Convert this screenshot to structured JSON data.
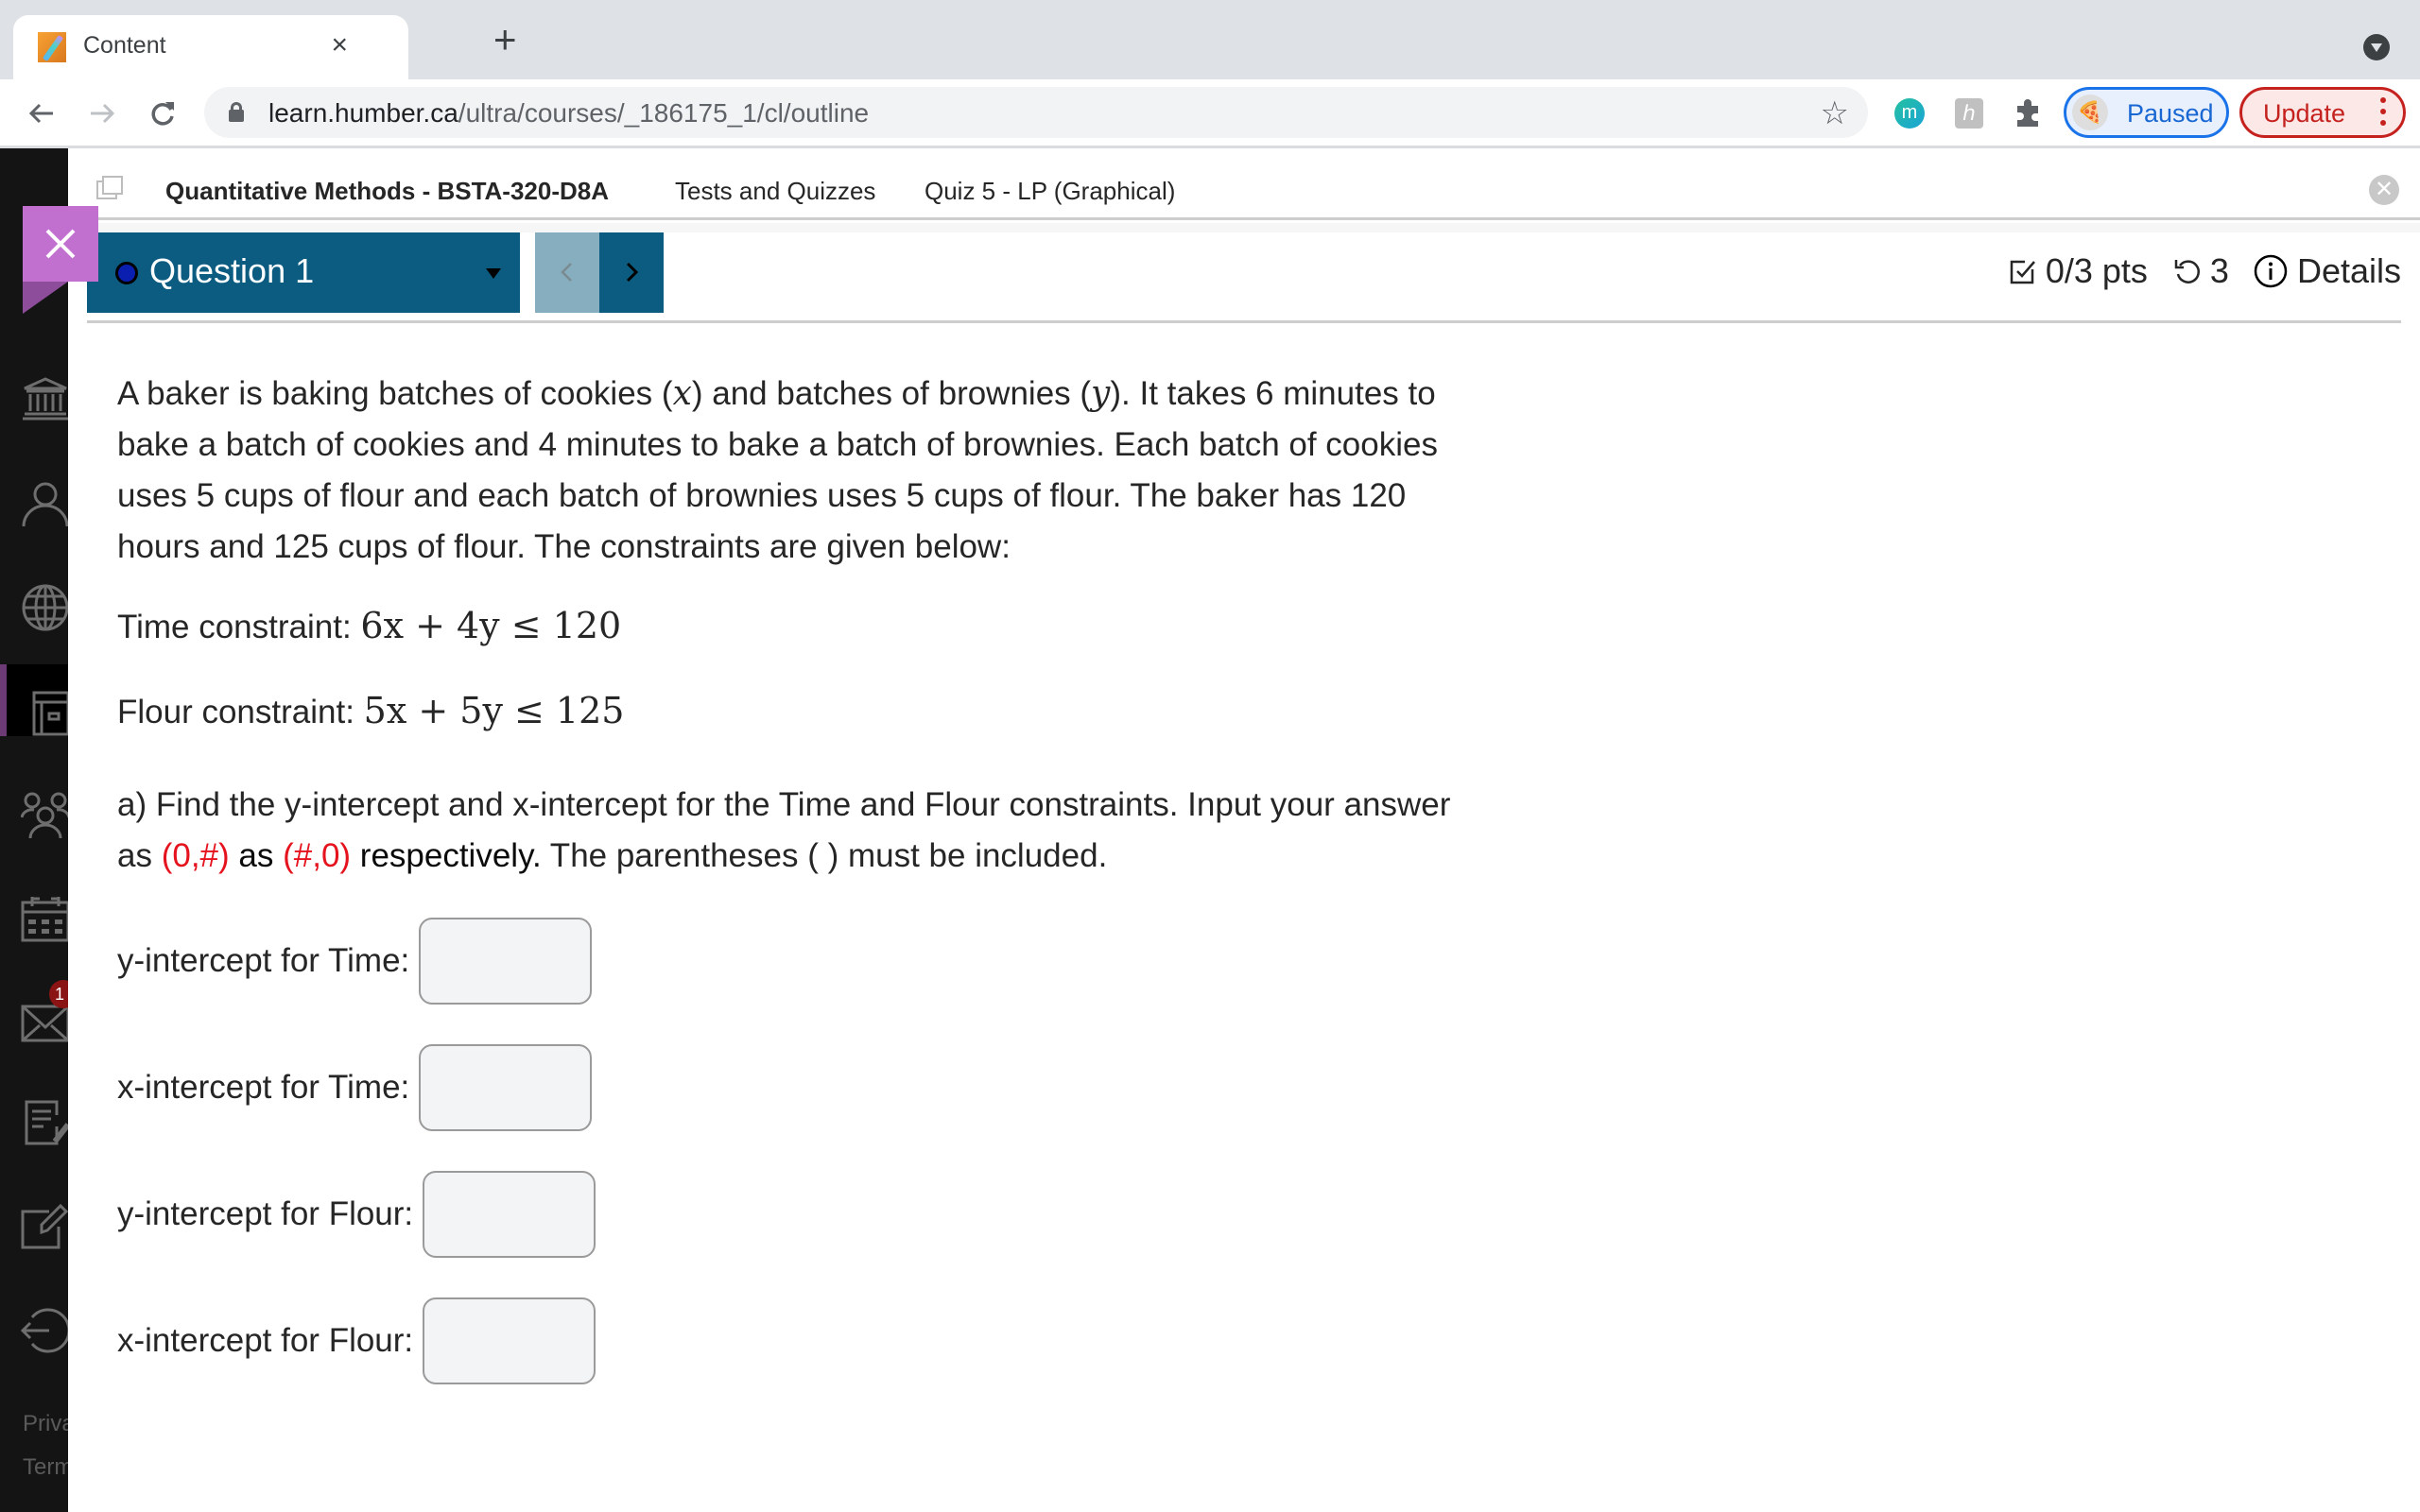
{
  "browser": {
    "tab_title": "Content",
    "tab_close": "×",
    "new_tab": "+",
    "url_host": "learn.humber.ca",
    "url_path": "/ultra/courses/_186175_1/cl/outline",
    "extension_m_label": "m",
    "extension_h_label": "ℎ",
    "profile_label": "Paused",
    "update_label": "Update",
    "star": "☆"
  },
  "leftnav": {
    "items": [
      {
        "name": "institution"
      },
      {
        "name": "profile"
      },
      {
        "name": "activity"
      },
      {
        "name": "courses",
        "active": true
      },
      {
        "name": "organizations"
      },
      {
        "name": "calendar"
      },
      {
        "name": "messages",
        "badge": "1"
      },
      {
        "name": "grades"
      },
      {
        "name": "tools"
      },
      {
        "name": "sign-out"
      }
    ],
    "footer": [
      "Privacy",
      "Terms"
    ]
  },
  "breadcrumb": {
    "course": "Quantitative Methods - BSTA-320-D8A",
    "section": "Tests and Quizzes",
    "page": "Quiz 5 - LP (Graphical)",
    "close": "✕"
  },
  "question_nav": {
    "current": "Question 1",
    "status_color": "#0a1fb0",
    "prev_enabled": false,
    "next_enabled": true
  },
  "question_meta": {
    "points": "0/3 pts",
    "attempts": "3",
    "details_label": "Details"
  },
  "question": {
    "p1_a": "A baker is baking batches of cookies (",
    "var_x": "x",
    "p1_b": ") and batches of brownies (",
    "var_y": "y",
    "p1_c": "). It takes 6 minutes to bake a batch of cookies and 4 minutes to bake a batch of brownies.  Each batch of cookies uses 5 cups of flour and each batch of brownies uses 5 cups of flour. The baker has 120 hours and 125 cups of flour. The constraints are given below:",
    "time_label": "Time constraint: ",
    "time_expr": "6x + 4y ≤ 120",
    "flour_label": "Flour constraint: ",
    "flour_expr": "5x + 5y ≤ 125",
    "part_a_1": "a) Find the y-intercept and x-intercept for the Time and Flour constraints. Input your answer as ",
    "part_a_fmt1": "(0,#)",
    "part_a_as": " as ",
    "part_a_fmt2": "(#,0)",
    "part_a_resp": " respectively.",
    "part_a_2": " The parentheses ( ) must be included.",
    "fields": [
      {
        "label": "y-intercept for Time:",
        "value": ""
      },
      {
        "label": "x-intercept for Time:",
        "value": ""
      },
      {
        "label": "y-intercept for Flour:",
        "value": ""
      },
      {
        "label": "x-intercept for Flour:",
        "value": ""
      }
    ]
  },
  "colors": {
    "accent": "#0c5c82",
    "accent_disabled": "#87aebf",
    "close_flag": "#c270d0",
    "highlight_red": "#e5131d",
    "nav_active": "#6c3a74"
  }
}
